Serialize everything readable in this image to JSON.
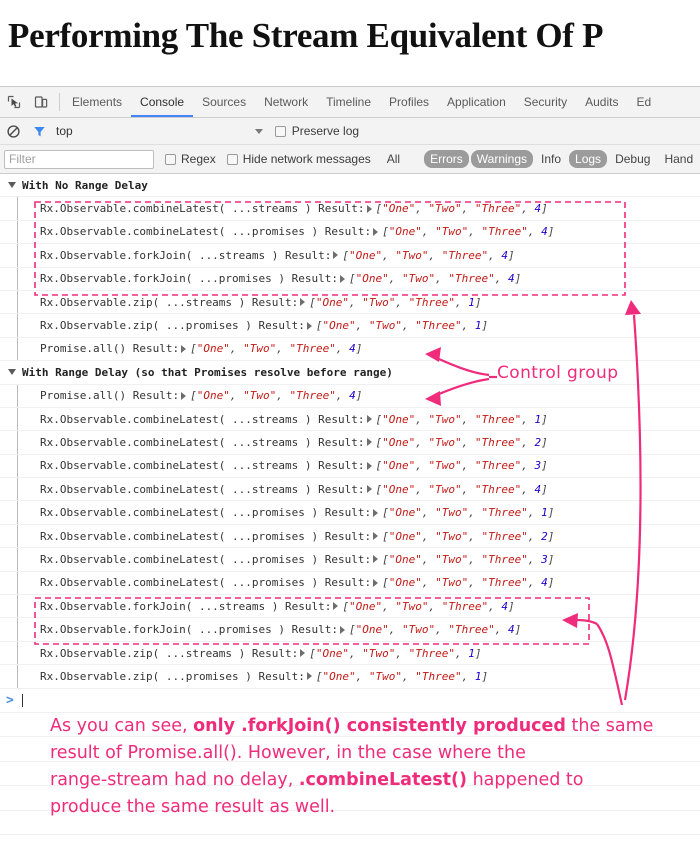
{
  "article": {
    "title": "Performing The Stream Equivalent Of P"
  },
  "devtools": {
    "toolbar": {
      "inspect_icon": "inspect-element-icon",
      "device_icon": "device-toolbar-icon",
      "tabs": [
        {
          "label": "Elements",
          "selected": false
        },
        {
          "label": "Console",
          "selected": true
        },
        {
          "label": "Sources",
          "selected": false
        },
        {
          "label": "Network",
          "selected": false
        },
        {
          "label": "Timeline",
          "selected": false
        },
        {
          "label": "Profiles",
          "selected": false
        },
        {
          "label": "Application",
          "selected": false
        },
        {
          "label": "Security",
          "selected": false
        },
        {
          "label": "Audits",
          "selected": false
        },
        {
          "label": "Ed",
          "selected": false
        }
      ]
    },
    "context_bar": {
      "clear_icon": "clear-console-icon",
      "filter_icon": "filter-funnel-icon",
      "context": "top",
      "preserve_log_label": "Preserve log",
      "preserve_log_checked": false
    },
    "filter_bar": {
      "filter_placeholder": "Filter",
      "filter_value": "",
      "regex_label": "Regex",
      "regex_checked": false,
      "hide_network_label": "Hide network messages",
      "hide_network_checked": false,
      "levels": [
        {
          "label": "All",
          "active": false
        },
        {
          "label": "Errors",
          "active": true
        },
        {
          "label": "Warnings",
          "active": true
        },
        {
          "label": "Info",
          "active": false
        },
        {
          "label": "Logs",
          "active": true
        },
        {
          "label": "Debug",
          "active": false
        },
        {
          "label": "Hand",
          "active": false
        }
      ]
    },
    "console": {
      "groups": [
        {
          "title": "With No Range Delay",
          "rows": [
            {
              "label": "Rx.Observable.combineLatest( ...streams ) Result:",
              "values": [
                "One",
                "Two",
                "Three"
              ],
              "number": 4
            },
            {
              "label": "Rx.Observable.combineLatest( ...promises ) Result:",
              "values": [
                "One",
                "Two",
                "Three"
              ],
              "number": 4
            },
            {
              "label": "Rx.Observable.forkJoin( ...streams ) Result:",
              "values": [
                "One",
                "Two",
                "Three"
              ],
              "number": 4
            },
            {
              "label": "Rx.Observable.forkJoin( ...promises ) Result:",
              "values": [
                "One",
                "Two",
                "Three"
              ],
              "number": 4
            },
            {
              "label": "Rx.Observable.zip( ...streams ) Result:",
              "values": [
                "One",
                "Two",
                "Three"
              ],
              "number": 1
            },
            {
              "label": "Rx.Observable.zip( ...promises ) Result:",
              "values": [
                "One",
                "Two",
                "Three"
              ],
              "number": 1
            },
            {
              "label": "Promise.all() Result:",
              "values": [
                "One",
                "Two",
                "Three"
              ],
              "number": 4
            }
          ]
        },
        {
          "title": "With Range Delay (so that Promises resolve before range)",
          "rows": [
            {
              "label": "Promise.all() Result:",
              "values": [
                "One",
                "Two",
                "Three"
              ],
              "number": 4
            },
            {
              "label": "Rx.Observable.combineLatest( ...streams ) Result:",
              "values": [
                "One",
                "Two",
                "Three"
              ],
              "number": 1
            },
            {
              "label": "Rx.Observable.combineLatest( ...streams ) Result:",
              "values": [
                "One",
                "Two",
                "Three"
              ],
              "number": 2
            },
            {
              "label": "Rx.Observable.combineLatest( ...streams ) Result:",
              "values": [
                "One",
                "Two",
                "Three"
              ],
              "number": 3
            },
            {
              "label": "Rx.Observable.combineLatest( ...streams ) Result:",
              "values": [
                "One",
                "Two",
                "Three"
              ],
              "number": 4
            },
            {
              "label": "Rx.Observable.combineLatest( ...promises ) Result:",
              "values": [
                "One",
                "Two",
                "Three"
              ],
              "number": 1
            },
            {
              "label": "Rx.Observable.combineLatest( ...promises ) Result:",
              "values": [
                "One",
                "Two",
                "Three"
              ],
              "number": 2
            },
            {
              "label": "Rx.Observable.combineLatest( ...promises ) Result:",
              "values": [
                "One",
                "Two",
                "Three"
              ],
              "number": 3
            },
            {
              "label": "Rx.Observable.combineLatest( ...promises ) Result:",
              "values": [
                "One",
                "Two",
                "Three"
              ],
              "number": 4
            },
            {
              "label": "Rx.Observable.forkJoin( ...streams ) Result:",
              "values": [
                "One",
                "Two",
                "Three"
              ],
              "number": 4
            },
            {
              "label": "Rx.Observable.forkJoin( ...promises ) Result:",
              "values": [
                "One",
                "Two",
                "Three"
              ],
              "number": 4
            },
            {
              "label": "Rx.Observable.zip( ...streams ) Result:",
              "values": [
                "One",
                "Two",
                "Three"
              ],
              "number": 1
            },
            {
              "label": "Rx.Observable.zip( ...promises ) Result:",
              "values": [
                "One",
                "Two",
                "Three"
              ],
              "number": 1
            }
          ]
        }
      ],
      "prompt": {
        "caret": ">",
        "value": ""
      }
    }
  },
  "annotations": {
    "accent_color": "#ef2b7b",
    "control_group_label": "Control group",
    "bottom_note": {
      "line1_a": "As you can see, ",
      "line1_b": "only .forkJoin() consistently produced",
      "line1_c": " the same",
      "line2": "result of Promise.all(). However, in the case where the",
      "line3_a": "range-stream had no delay, ",
      "line3_b": ".combineLatest()",
      "line3_c": " happened to",
      "line4": "produce the same result as well."
    }
  }
}
